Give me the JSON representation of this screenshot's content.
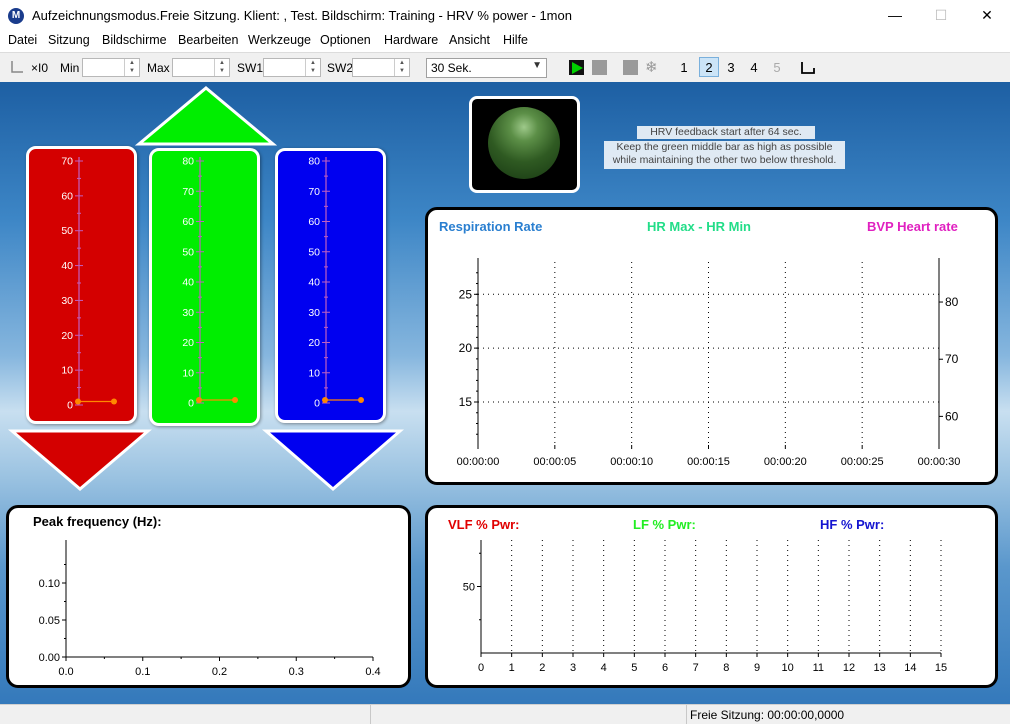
{
  "window": {
    "title": "Aufzeichnungsmodus.Freie Sitzung. Klient: , Test. Bildschirm: Training - HRV % power - 1mon",
    "minimize": "—",
    "maximize": "☐",
    "close": "✕"
  },
  "menu": [
    "Datei",
    "Sitzung",
    "Bildschirme",
    "Bearbeiten",
    "Werkzeuge",
    "Optionen",
    "Hardware",
    "Ansicht",
    "Hilfe"
  ],
  "toolbar": {
    "scale_label": "×I0",
    "min_label": "Min",
    "max_label": "Max",
    "sw1_label": "SW1",
    "sw2_label": "SW2",
    "time_window": "30 Sek.",
    "screens": [
      "1",
      "2",
      "3",
      "4",
      "5"
    ],
    "active_screen": "2"
  },
  "bars": {
    "red": {
      "color": "#d40000",
      "ticks": [
        "70",
        "60",
        "50",
        "40",
        "30",
        "20",
        "10",
        "0"
      ],
      "value": 1,
      "max": 70
    },
    "green": {
      "color": "#00ee00",
      "ticks": [
        "80",
        "70",
        "60",
        "50",
        "40",
        "30",
        "20",
        "10",
        "0"
      ],
      "value": 1,
      "max": 80
    },
    "blue": {
      "color": "#0000f0",
      "ticks": [
        "80",
        "70",
        "60",
        "50",
        "40",
        "30",
        "20",
        "10",
        "0"
      ],
      "value": 1,
      "max": 80
    }
  },
  "arrows": {
    "up": "#00ee00",
    "down_left": "#d40000",
    "down_right": "#0000f0"
  },
  "feedback_note": {
    "line1": "HRV feedback start after 64 sec.",
    "line2": "Keep the green middle bar as high as possible",
    "line3": "while maintaining the other two below threshold."
  },
  "chart_data": [
    {
      "type": "line",
      "series": [
        {
          "name": "Respiration Rate",
          "color": "#2a7fd0",
          "values": []
        },
        {
          "name": "HR Max - HR Min",
          "color": "#22dd88",
          "values": []
        },
        {
          "name": "BVP Heart rate",
          "color": "#e020c0",
          "values": []
        }
      ],
      "xticks": [
        "00:00:00",
        "00:00:05",
        "00:00:10",
        "00:00:15",
        "00:00:20",
        "00:00:25",
        "00:00:30"
      ],
      "yticks_left": [
        "25",
        "20",
        "15"
      ],
      "yticks_right": [
        "80",
        "70",
        "60"
      ],
      "ylim_left": [
        11,
        28
      ],
      "ylim_right": [
        55,
        87
      ],
      "grid": true
    },
    {
      "type": "line",
      "title": "Peak frequency (Hz):",
      "series": [],
      "xticks": [
        "0.0",
        "0.1",
        "0.2",
        "0.3",
        "0.4"
      ],
      "xlim": [
        0,
        0.4
      ],
      "yticks": [
        "0.10",
        "0.05",
        "0.00"
      ],
      "ylim": [
        0,
        0.15
      ],
      "grid": false
    },
    {
      "type": "bar",
      "series": [
        {
          "name": "VLF % Pwr:",
          "color": "#e00000",
          "values": []
        },
        {
          "name": "LF % Pwr:",
          "color": "#22ee22",
          "values": []
        },
        {
          "name": "HF % Pwr:",
          "color": "#1515d0",
          "values": []
        }
      ],
      "xticks": [
        "0",
        "1",
        "2",
        "3",
        "4",
        "5",
        "6",
        "7",
        "8",
        "9",
        "10",
        "11",
        "12",
        "13",
        "14",
        "15"
      ],
      "yticks": [
        "50"
      ],
      "ylim": [
        0,
        85
      ],
      "grid": true
    }
  ],
  "status": {
    "session": "Freie Sitzung: 00:00:00,0000"
  }
}
